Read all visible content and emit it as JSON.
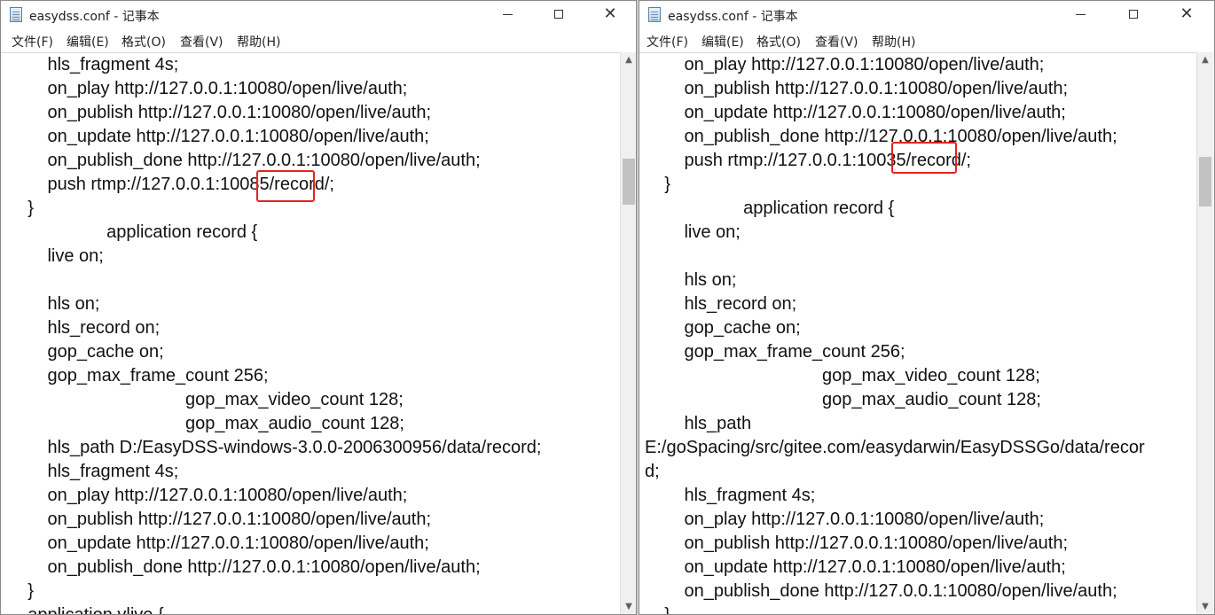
{
  "windows": [
    {
      "title": "easydss.conf - 记事本",
      "menu": [
        "文件(F)",
        "编辑(E)",
        "格式(O)",
        "查看(V)",
        "帮助(H)"
      ],
      "lines": [
        "        hls_fragment 4s;",
        "        on_play http://127.0.0.1:10080/open/live/auth;",
        "        on_publish http://127.0.0.1:10080/open/live/auth;",
        "        on_update http://127.0.0.1:10080/open/live/auth;",
        "        on_publish_done http://127.0.0.1:10080/open/live/auth;",
        "        push rtmp://127.0.0.1:10085/record/;",
        "    }",
        "                    application record {",
        "        live on;",
        "",
        "        hls on;",
        "        hls_record on;",
        "        gop_cache on;",
        "        gop_max_frame_count 256;",
        "                                    gop_max_video_count 128;",
        "                                    gop_max_audio_count 128;",
        "        hls_path D:/EasyDSS-windows-3.0.0-2006300956/data/record;",
        "        hls_fragment 4s;",
        "        on_play http://127.0.0.1:10080/open/live/auth;",
        "        on_publish http://127.0.0.1:10080/open/live/auth;",
        "        on_update http://127.0.0.1:10080/open/live/auth;",
        "        on_publish_done http://127.0.0.1:10080/open/live/auth;",
        "    }",
        "    application vlive {"
      ]
    },
    {
      "title": "easydss.conf - 记事本",
      "menu": [
        "文件(F)",
        "编辑(E)",
        "格式(O)",
        "查看(V)",
        "帮助(H)"
      ],
      "lines": [
        "        on_play http://127.0.0.1:10080/open/live/auth;",
        "        on_publish http://127.0.0.1:10080/open/live/auth;",
        "        on_update http://127.0.0.1:10080/open/live/auth;",
        "        on_publish_done http://127.0.0.1:10080/open/live/auth;",
        "        push rtmp://127.0.0.1:10035/record/;",
        "    }",
        "                    application record {",
        "        live on;",
        "",
        "        hls on;",
        "        hls_record on;",
        "        gop_cache on;",
        "        gop_max_frame_count 256;",
        "                                    gop_max_video_count 128;",
        "                                    gop_max_audio_count 128;",
        "        hls_path",
        "E:/goSpacing/src/gitee.com/easydarwin/EasyDSSGo/data/recor",
        "d;",
        "        hls_fragment 4s;",
        "        on_play http://127.0.0.1:10080/open/live/auth;",
        "        on_publish http://127.0.0.1:10080/open/live/auth;",
        "        on_update http://127.0.0.1:10080/open/live/auth;",
        "        on_publish_done http://127.0.0.1:10080/open/live/auth;",
        "    }"
      ]
    }
  ],
  "highlight_color": "#e3241c"
}
